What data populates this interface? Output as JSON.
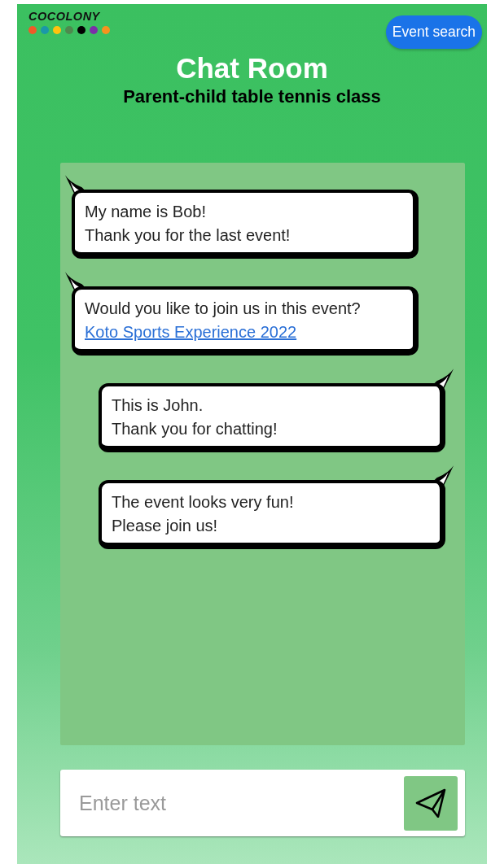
{
  "logo": {
    "text": "COCOLONY",
    "dots": [
      {
        "color": "#f05a28"
      },
      {
        "color": "#1b98a8"
      },
      {
        "color": "#ffc20e"
      },
      {
        "color": "#4e8a4e"
      },
      {
        "color": "#000000"
      },
      {
        "color": "#7b2fa8"
      },
      {
        "color": "#f7931e"
      }
    ]
  },
  "header_button": {
    "label": "Event search"
  },
  "title": "Chat Room",
  "subtitle": "Parent-child table tennis class",
  "messages": [
    {
      "kind": "left",
      "lines": [
        {
          "kind": "text",
          "text": "My name is Bob!"
        },
        {
          "kind": "text",
          "text": "Thank you for the last event!"
        }
      ]
    },
    {
      "kind": "left",
      "lines": [
        {
          "kind": "text",
          "text": "Would you like to join us in this event?"
        },
        {
          "kind": "link",
          "text": "Koto Sports Experience 2022"
        }
      ]
    },
    {
      "kind": "right",
      "lines": [
        {
          "kind": "text",
          "text": "This is John."
        },
        {
          "kind": "text",
          "text": "Thank you for chatting!"
        }
      ]
    },
    {
      "kind": "right",
      "lines": [
        {
          "kind": "text",
          "text": "The event looks very fun!"
        },
        {
          "kind": "text",
          "text": "Please join us!"
        }
      ]
    }
  ],
  "composer": {
    "placeholder": "Enter text"
  }
}
